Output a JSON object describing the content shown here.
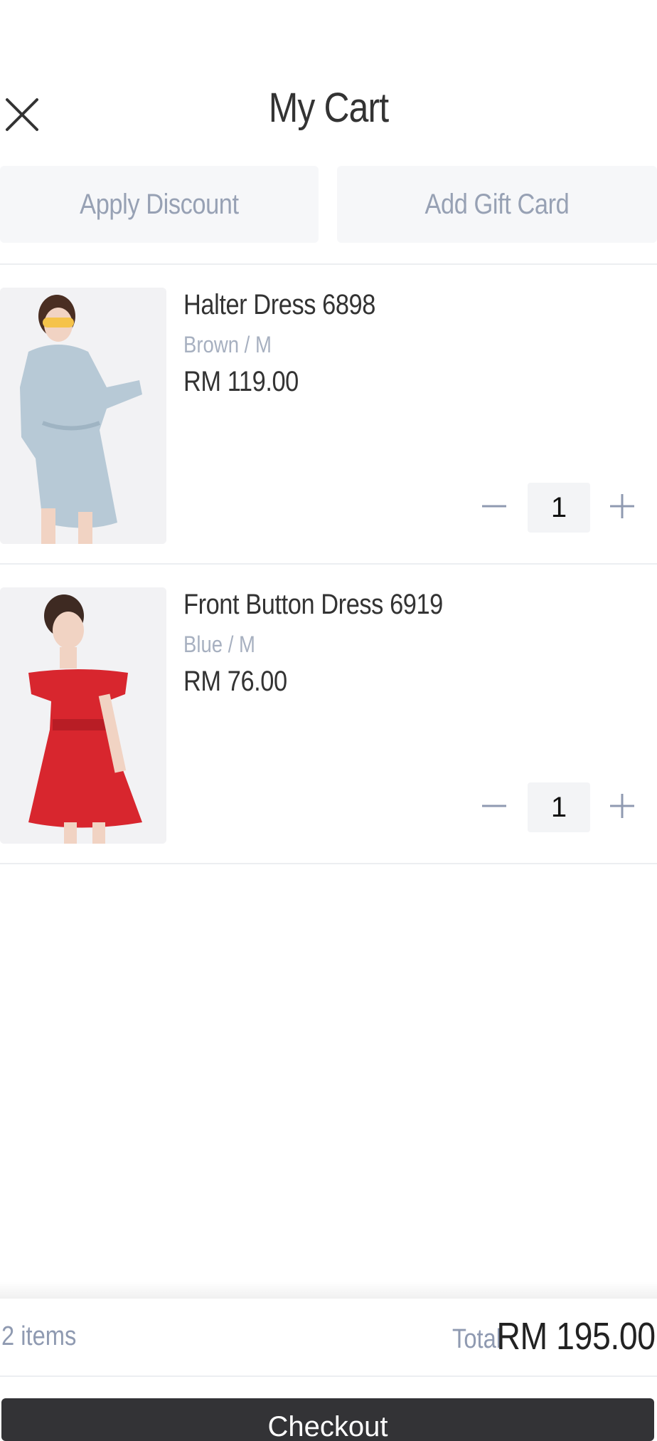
{
  "header": {
    "title": "My Cart",
    "close_icon": "close-icon"
  },
  "promos": {
    "discount_label": "Apply Discount",
    "gift_card_label": "Add Gift Card"
  },
  "items": [
    {
      "name": "Halter Dress 6898",
      "variant": "Brown / M",
      "price": "RM 119.00",
      "quantity": "1",
      "image": "product-photo-blue-dress"
    },
    {
      "name": "Front Button Dress 6919",
      "variant": "Blue / M",
      "price": "RM 76.00",
      "quantity": "1",
      "image": "product-photo-red-dress"
    }
  ],
  "summary": {
    "count": "2 items",
    "total_label": "Total",
    "total_value": "RM 195.00"
  },
  "checkout": {
    "label": "Checkout"
  },
  "colors": {
    "accent_muted": "#97a1b4",
    "button_dark": "#333336",
    "surface": "#f6f7f9"
  }
}
